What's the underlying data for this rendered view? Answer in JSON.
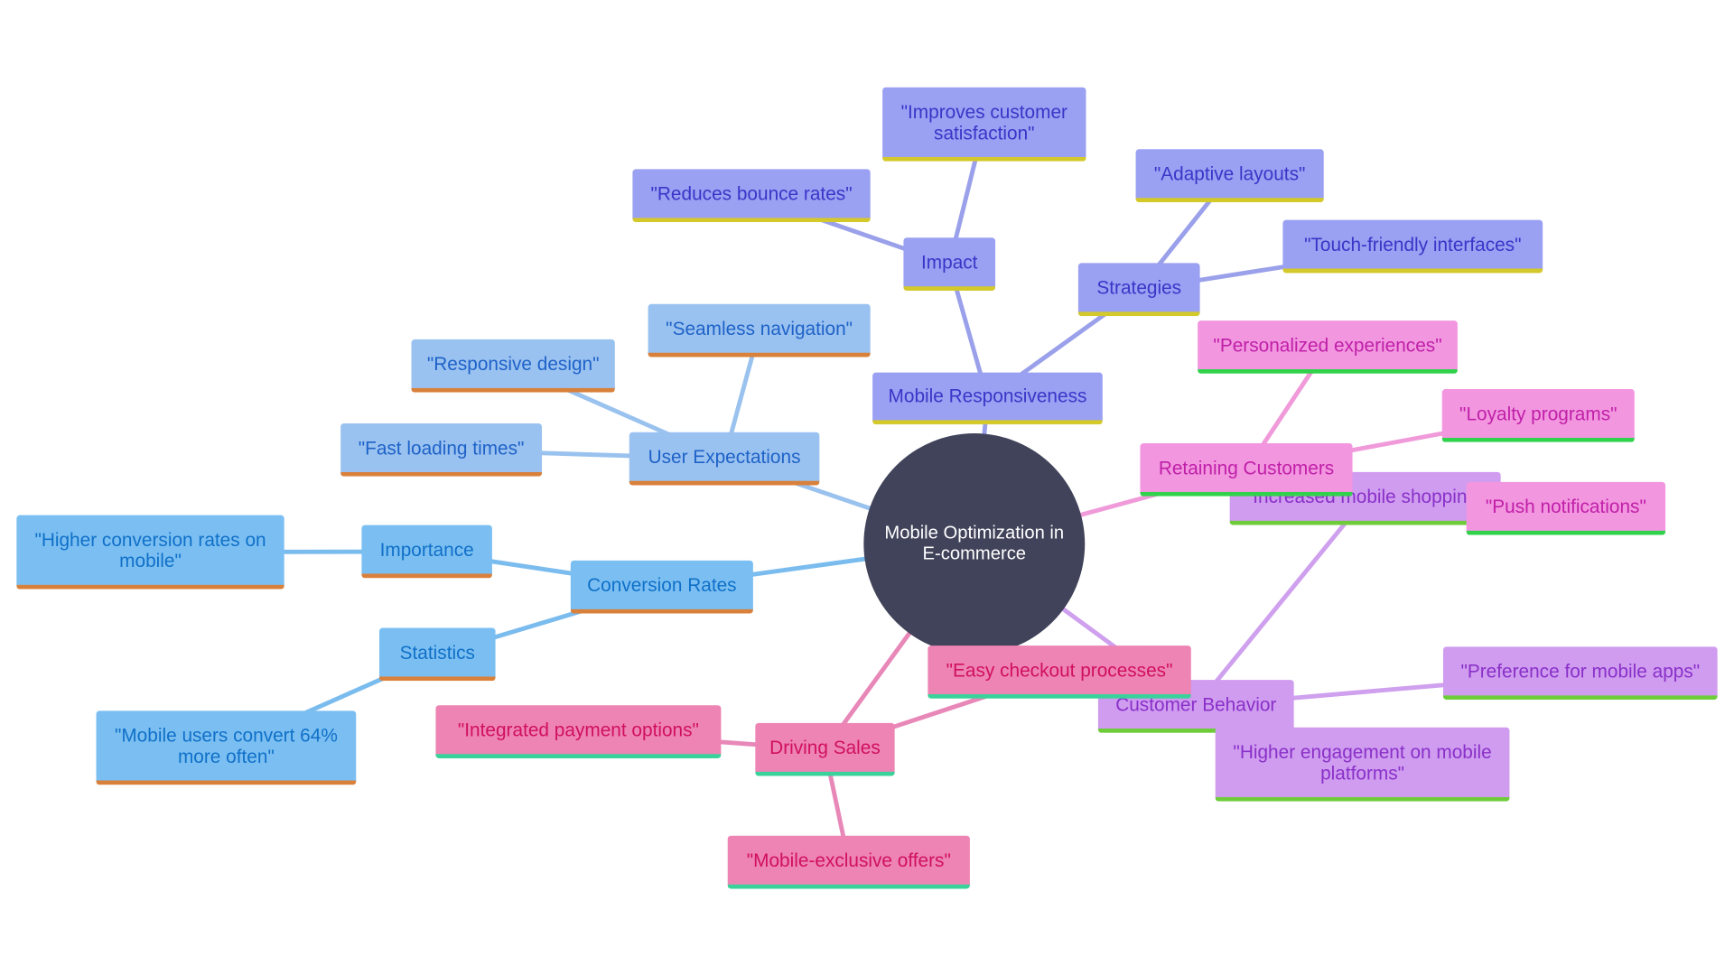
{
  "root": {
    "label": "Mobile Optimization in E-commerce",
    "color": "#40435a"
  },
  "branches": [
    {
      "label": "Mobile Responsiveness",
      "colors": {
        "bg": "#9aa0f2",
        "text": "#3b35c8",
        "accent": "#d4c92a",
        "edge": "#9aa0ea"
      },
      "children": [
        {
          "label": "Impact",
          "children": [
            {
              "label": "\"Improves customer satisfaction\""
            },
            {
              "label": "\"Reduces bounce rates\""
            }
          ]
        },
        {
          "label": "Strategies",
          "children": [
            {
              "label": "\"Adaptive layouts\""
            },
            {
              "label": "\"Touch-friendly interfaces\""
            }
          ]
        }
      ]
    },
    {
      "label": "User Expectations",
      "colors": {
        "bg": "#9ac2f0",
        "text": "#1e62c8",
        "accent": "#d9803a",
        "edge": "#9ac2ee"
      },
      "children": [
        {
          "label": "\"Seamless navigation\""
        },
        {
          "label": "\"Responsive design\""
        },
        {
          "label": "\"Fast loading times\""
        }
      ]
    },
    {
      "label": "Conversion Rates",
      "colors": {
        "bg": "#7bbff2",
        "text": "#1070c8",
        "accent": "#d9803a",
        "edge": "#7bbcee"
      },
      "children": [
        {
          "label": "Importance",
          "children": [
            {
              "label": "\"Higher conversion rates on mobile\""
            }
          ]
        },
        {
          "label": "Statistics",
          "children": [
            {
              "label": "\"Mobile users convert 64% more often\""
            }
          ]
        }
      ]
    },
    {
      "label": "Customer Behavior",
      "colors": {
        "bg": "#cf9cf0",
        "text": "#8a30c8",
        "accent": "#6ecc3a",
        "edge": "#cfa0ee"
      },
      "children": [
        {
          "label": "\"Increased mobile shopping\""
        },
        {
          "label": "\"Preference for mobile apps\""
        },
        {
          "label": "\"Higher engagement on mobile platforms\""
        }
      ]
    },
    {
      "label": "Retaining Customers",
      "colors": {
        "bg": "#f296e0",
        "text": "#c020a8",
        "accent": "#2fd24a",
        "edge": "#f09ada"
      },
      "children": [
        {
          "label": "\"Personalized experiences\""
        },
        {
          "label": "\"Loyalty programs\""
        },
        {
          "label": "\"Push notifications\""
        }
      ]
    },
    {
      "label": "Driving Sales",
      "colors": {
        "bg": "#ee84b4",
        "text": "#d01060",
        "accent": "#3ad29a",
        "edge": "#e888b8"
      },
      "children": [
        {
          "label": "\"Easy checkout processes\""
        },
        {
          "label": "\"Integrated payment options\""
        },
        {
          "label": "\"Mobile-exclusive offers\""
        }
      ]
    }
  ]
}
